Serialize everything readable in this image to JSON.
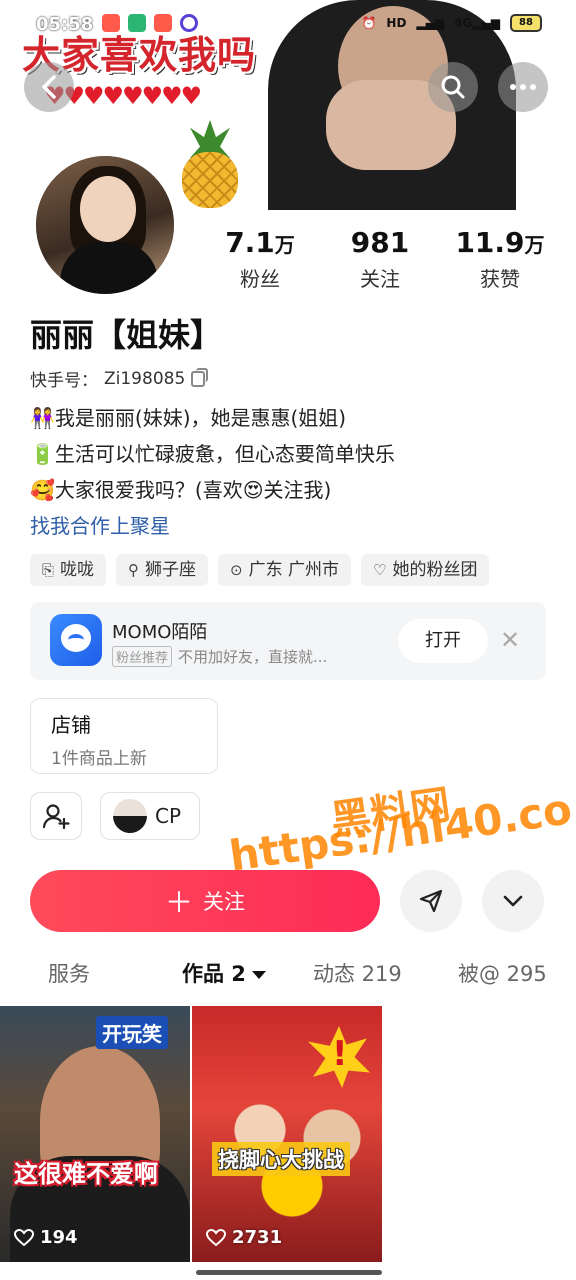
{
  "status_bar": {
    "time": "05:58",
    "battery": "88"
  },
  "banner": {
    "headline": "大家喜欢我吗",
    "hearts": "♥♥♥♥♥♥♥♥"
  },
  "profile": {
    "stats": [
      {
        "value": "7.1",
        "unit": "万",
        "label": "粉丝"
      },
      {
        "value": "981",
        "unit": "",
        "label": "关注"
      },
      {
        "value": "11.9",
        "unit": "万",
        "label": "获赞"
      }
    ],
    "name": "丽丽【姐妹】",
    "uid_label": "快手号：",
    "uid": "Zi198085",
    "bio": [
      "👭我是丽丽(妹妹)，她是惠惠(姐姐)",
      "🔋生活可以忙碌疲惫，但心态要简单快乐",
      "🥰大家很爱我吗？(喜欢😍关注我)"
    ],
    "link": "找我合作上聚星",
    "tags": [
      {
        "icon": "⎘",
        "label": "咙咙"
      },
      {
        "icon": "⚲",
        "label": "狮子座"
      },
      {
        "icon": "⊙",
        "label": "广东 广州市"
      },
      {
        "icon": "♡",
        "label": "她的粉丝团"
      }
    ]
  },
  "ad": {
    "title": "MOMO陌陌",
    "badge": "粉丝推荐",
    "subtitle": "不用加好友，直接就...",
    "open_label": "打开",
    "close": "✕"
  },
  "shop": {
    "title": "店铺",
    "subtitle": "1件商品上新"
  },
  "cp": {
    "label": "CP"
  },
  "actions": {
    "follow_label": "关注",
    "follow_plus": "＋"
  },
  "watermark": {
    "line1": "黑料网",
    "line2": "https://hl40.co"
  },
  "tabs": [
    {
      "label": "服务"
    },
    {
      "label": "作品 2"
    },
    {
      "label": "动态 219"
    },
    {
      "label": "被@ 295"
    }
  ],
  "videos": [
    {
      "badge": "开玩笑",
      "caption": "这很难不爱啊",
      "likes": "194"
    },
    {
      "badge": "",
      "caption": "挠脚心大挑战",
      "likes": "2731"
    }
  ]
}
